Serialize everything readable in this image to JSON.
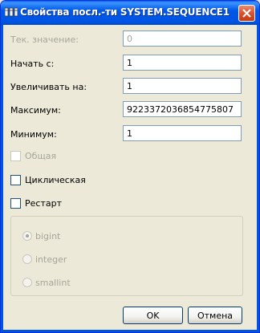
{
  "window": {
    "title": "Свойства посл.-ти SYSTEM.SEQUENCE1",
    "icon": "database-icon"
  },
  "fields": {
    "current_value": {
      "label": "Тек. значение:",
      "value": "0",
      "disabled": true
    },
    "start_with": {
      "label": "Начать с:",
      "value": "1"
    },
    "increment_by": {
      "label": "Увеличивать на:",
      "value": "1"
    },
    "maximum": {
      "label": "Максимум:",
      "value": "9223372036854775807"
    },
    "minimum": {
      "label": "Минимум:",
      "value": "1"
    }
  },
  "checkboxes": {
    "shared": {
      "label": "Общая",
      "checked": false,
      "disabled": true
    },
    "cyclic": {
      "label": "Циклическая",
      "checked": false
    },
    "restart": {
      "label": "Рестарт",
      "checked": false
    }
  },
  "data_type": {
    "options": [
      "bigint",
      "integer",
      "smallint"
    ],
    "selected": "bigint",
    "disabled": true
  },
  "buttons": {
    "ok": "OK",
    "cancel": "Отмена"
  },
  "colors": {
    "titlebar": "#0054e3",
    "dialog_bg": "#ece9d8",
    "disabled_text": "#a6a59a",
    "close_button": "#d8532e"
  }
}
